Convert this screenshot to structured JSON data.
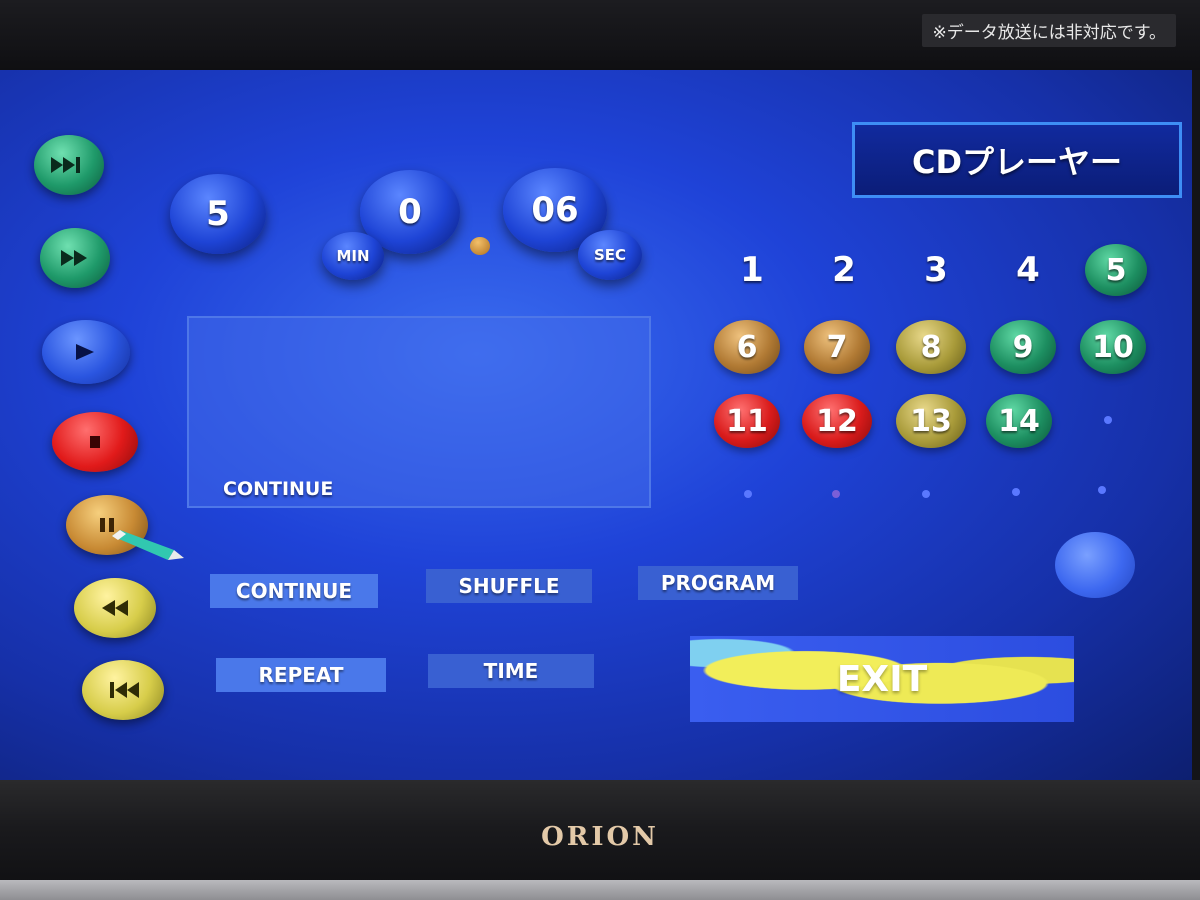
{
  "notice": "※データ放送には非対応です。",
  "title": "CDプレーヤー",
  "brand": "ORION",
  "time": {
    "track": "5",
    "minutes": "0",
    "seconds": "06",
    "min_label": "MIN",
    "sec_label": "SEC"
  },
  "display": {
    "status": "CONTINUE"
  },
  "controls": [
    {
      "icon": "skip-forward-icon",
      "color": "#1f9a6a"
    },
    {
      "icon": "fast-forward-icon",
      "color": "#1f9a6a"
    },
    {
      "icon": "play-icon",
      "color": "#2a55e0"
    },
    {
      "icon": "stop-icon",
      "color": "#e11a1a"
    },
    {
      "icon": "pause-icon",
      "color": "#c88a34"
    },
    {
      "icon": "rewind-icon",
      "color": "#d7cd4a"
    },
    {
      "icon": "skip-back-icon",
      "color": "#d7cd4a"
    }
  ],
  "tracks": [
    "1",
    "2",
    "3",
    "4",
    "5",
    "6",
    "7",
    "8",
    "9",
    "10",
    "11",
    "12",
    "13",
    "14"
  ],
  "modes": {
    "continue": "CONTINUE",
    "shuffle": "SHUFFLE",
    "program": "PROGRAM",
    "repeat": "REPEAT",
    "time": "TIME"
  },
  "exit": "EXIT"
}
